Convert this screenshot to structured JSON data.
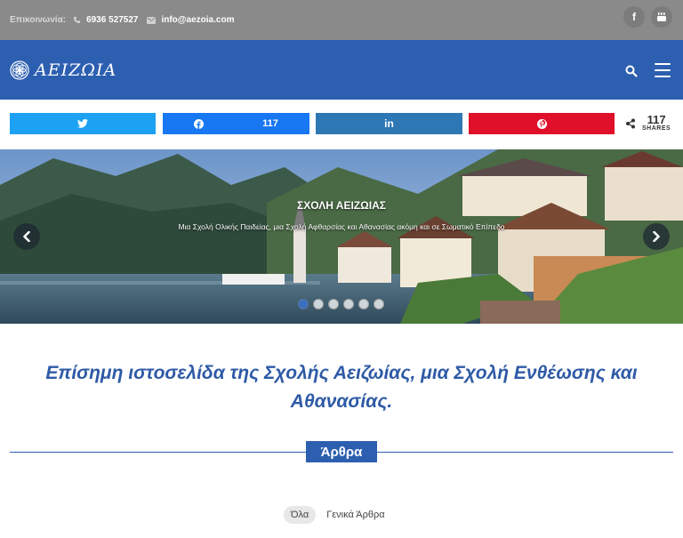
{
  "topbar": {
    "contact_label": "Επικοινωνία:",
    "phone": "6936 527527",
    "email": "info@aezoia.com",
    "social": [
      "facebook-icon",
      "youtube-icon"
    ]
  },
  "header": {
    "logo_text": "ΑΕΙΖΩΙΑ",
    "brand_color": "#2d5fb0"
  },
  "share_bar": {
    "facebook_count": "117",
    "total_count": "117",
    "total_label": "SHARES",
    "colors": {
      "twitter": "#1da1f2",
      "facebook": "#1877f2",
      "linkedin": "#2d78b4",
      "pinterest": "#e0102a"
    }
  },
  "hero": {
    "title": "ΣΧΟΛΗ ΑΕΙΖΩΙΑΣ",
    "subtitle": "Μια Σχολή Ολικής Παιδείας, μια Σχολή Αφθαρσίας και Αθανασίας ακόμη και σε Σωματικό Επίπεδο",
    "slide_count": 6,
    "active_slide": 0
  },
  "tagline": "Επίσημη ιστοσελίδα της Σχολής Αειζωίας, μια Σχολή Ενθέωσης και Αθανασίας.",
  "articles": {
    "heading": "Άρθρα",
    "filters": [
      "Όλα",
      "Γενικά Άρθρα"
    ],
    "active_filter": "Όλα"
  }
}
